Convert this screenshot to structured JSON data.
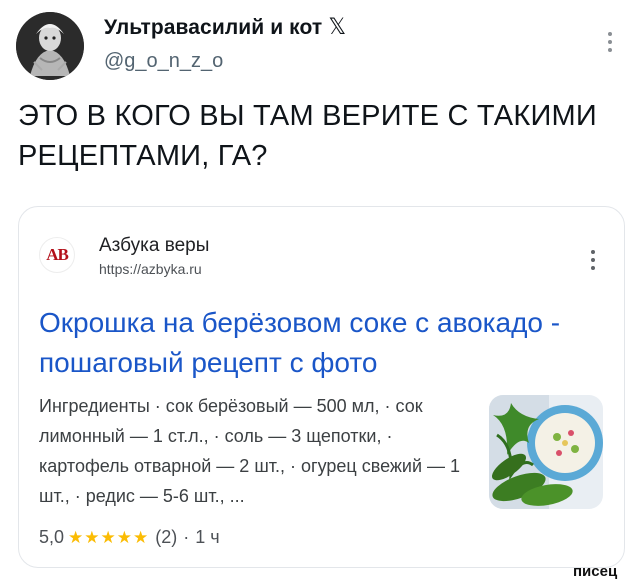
{
  "author": {
    "name": "Ультравасилий и кот",
    "handle": "@g_o_n_z_o",
    "platform_icon": "x-logo-icon",
    "more_icon": "more-vertical-icon"
  },
  "tweet": {
    "text": "ЭТО В КОГО ВЫ ТАМ ВЕРИТЕ С ТАКИМИ РЕЦЕПТАМИ, ГА?"
  },
  "card": {
    "site_logo_text": "АВ",
    "site_name": "Азбука веры",
    "site_url": "https://azbyka.ru",
    "more_icon": "more-vertical-icon",
    "title": "Окрошка на берёзовом соке с авокадо - пошаговый рецепт с фото",
    "snippet": "Ингредиенты · сок берёзовый — 500 мл, · сок лимонный — 1 ст.л., · соль — 3 щепотки, · картофель отварной — 2 шт., · огурец свежий — 1 шт., · редис — 5-6 шт., ...",
    "thumbnail_icon": "okroshka-thumbnail",
    "rating": "5,0",
    "stars": "★★★★★",
    "review_count": "(2)",
    "separator": "·",
    "time": "1 ч"
  },
  "watermark": "писец",
  "colors": {
    "link": "#1a56c8",
    "star": "#fbbc04",
    "handle": "#536471",
    "site_logo": "#b3101a"
  }
}
